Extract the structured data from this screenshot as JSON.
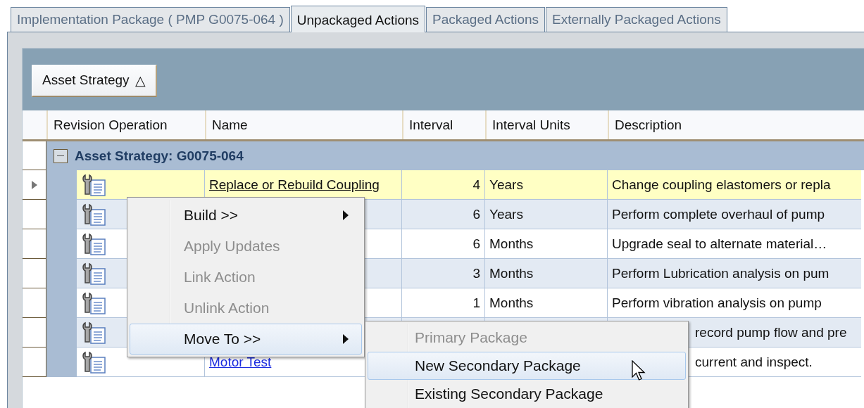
{
  "tabs": [
    {
      "label": "Implementation Package ( PMP G0075-064 )",
      "selected": false
    },
    {
      "label": "Unpackaged Actions",
      "selected": true
    },
    {
      "label": "Packaged Actions",
      "selected": false
    },
    {
      "label": "Externally Packaged Actions",
      "selected": false
    }
  ],
  "grid": {
    "group_by_button": {
      "label": "Asset Strategy",
      "sort_glyph": "△"
    },
    "columns": [
      "Revision Operation",
      "Name",
      "Interval",
      "Interval Units",
      "Description"
    ],
    "group": {
      "label": "Asset Strategy: G0075-064",
      "expanded": true
    },
    "rows": [
      {
        "current": true,
        "name": "Replace or Rebuild Coupling",
        "interval": "4",
        "units": "Years",
        "description": "Change coupling elastomers or repla"
      },
      {
        "current": false,
        "interval": "6",
        "units": "Years",
        "description": "Perform complete overhaul of pump"
      },
      {
        "current": false,
        "interval": "6",
        "units": "Months",
        "description": "Upgrade seal to alternate material…"
      },
      {
        "current": false,
        "interval": "3",
        "units": "Months",
        "description": "Perform Lubrication analysis on pum"
      },
      {
        "current": false,
        "interval": "1",
        "units": "Months",
        "description": "Perform vibration analysis on pump"
      },
      {
        "current": false,
        "description": "record pump flow and pre"
      },
      {
        "current": false,
        "name": "Motor Test",
        "description": "current and inspect."
      }
    ]
  },
  "context_menu": {
    "items": [
      {
        "label": "Build >>",
        "disabled": false,
        "highlighted": false,
        "submenu": true
      },
      {
        "label": "Apply Updates",
        "disabled": true,
        "highlighted": false,
        "submenu": false
      },
      {
        "label": "Link Action",
        "disabled": true,
        "highlighted": false,
        "submenu": false
      },
      {
        "label": "Unlink Action",
        "disabled": true,
        "highlighted": false,
        "submenu": false
      },
      {
        "label": "Move To >>",
        "disabled": false,
        "highlighted": true,
        "submenu": true
      }
    ]
  },
  "submenu": {
    "items": [
      {
        "label": "Primary Package",
        "disabled": true,
        "highlighted": false
      },
      {
        "label": "New Secondary Package",
        "disabled": false,
        "highlighted": true
      },
      {
        "label": "Existing Secondary Package",
        "disabled": false,
        "highlighted": false
      }
    ]
  }
}
